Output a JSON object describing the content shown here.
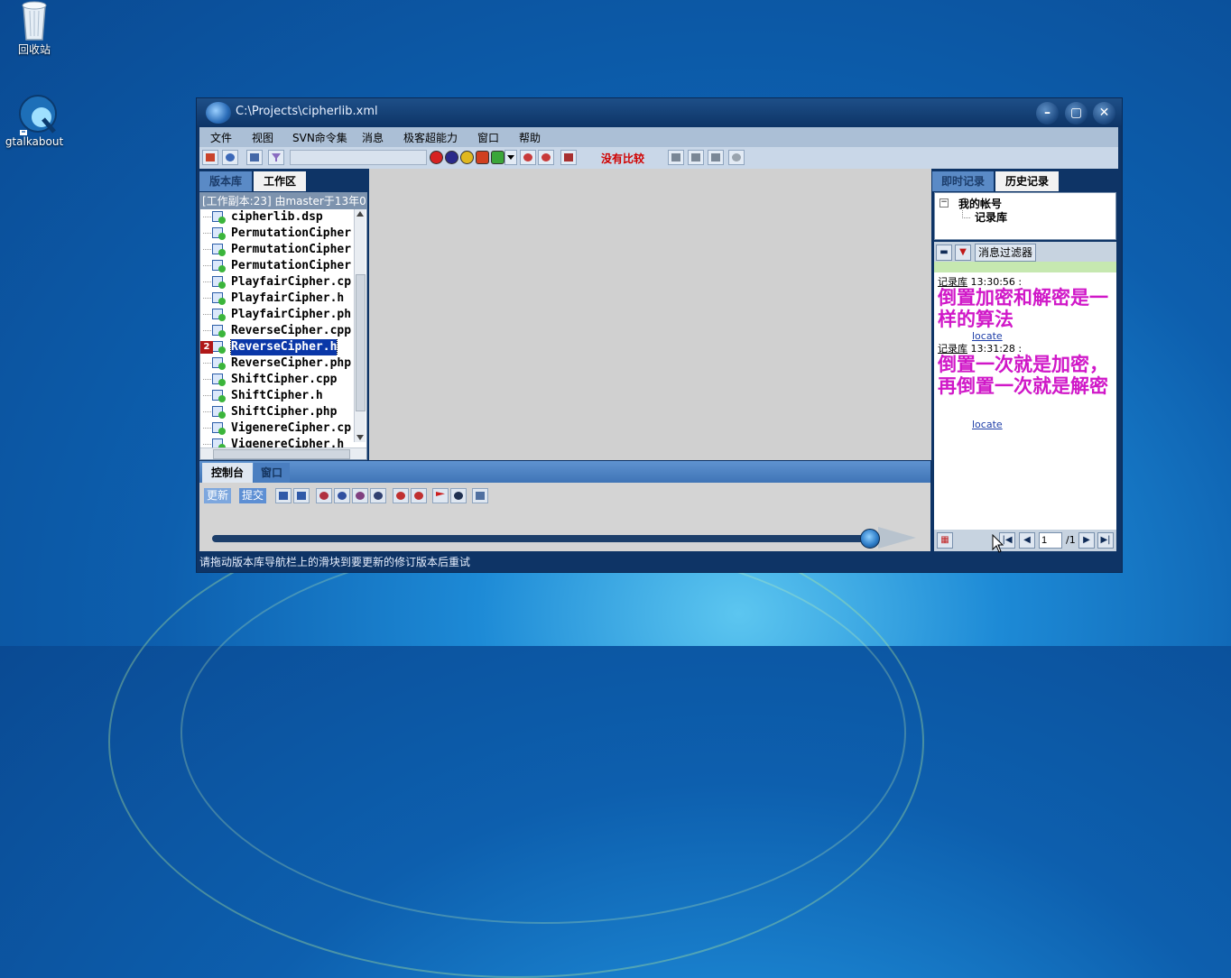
{
  "desktop": {
    "recycle_bin_label": "回收站",
    "gtalk_label": "gtalkabout"
  },
  "window": {
    "title": "C:\\Projects\\cipherlib.xml",
    "controls": [
      "minimize",
      "maximize",
      "close"
    ]
  },
  "menu": [
    "文件",
    "视图",
    "SVN命令集",
    "消息",
    "极客超能力",
    "窗口",
    "帮助"
  ],
  "toolbar": {
    "compare_status": "没有比较"
  },
  "left_panel": {
    "tabs": [
      "版本库",
      "工作区"
    ],
    "active_tab": "工作区",
    "header": "[工作副本:23] 由master于13年0...",
    "files": [
      "cipherlib.dsp",
      "PermutationCipher",
      "PermutationCipher",
      "PermutationCipher",
      "PlayfairCipher.cp",
      "PlayfairCipher.h",
      "PlayfairCipher.ph",
      "ReverseCipher.cpp",
      "ReverseCipher.h",
      "ReverseCipher.php",
      "ShiftCipher.cpp",
      "ShiftCipher.h",
      "ShiftCipher.php",
      "VigenereCipher.cp",
      "VigenereCipher.h"
    ],
    "selected_file": "ReverseCipher.h",
    "selected_badge": "2"
  },
  "console": {
    "tabs": [
      "控制台",
      "窗口"
    ],
    "active_tab": "控制台",
    "update_label": "更新",
    "commit_label": "提交"
  },
  "status_bar": "请拖动版本库导航栏上的滑块到要更新的修订版本后重试",
  "right_panel": {
    "tabs": [
      "即时记录",
      "历史记录"
    ],
    "active_tab": "历史记录",
    "tree_root": "我的帐号",
    "tree_child": "记录库",
    "filter_label": "消息过滤器",
    "messages": [
      {
        "source": "记录库",
        "time": "13:30:56 :",
        "text": "倒置加密和解密是一样的算法",
        "link": "locate"
      },
      {
        "source": "记录库",
        "time": "13:31:28 :",
        "text": "倒置一次就是加密，再倒置一次就是解密",
        "link": "locate"
      }
    ],
    "page_input": "1",
    "page_total": "/1"
  }
}
